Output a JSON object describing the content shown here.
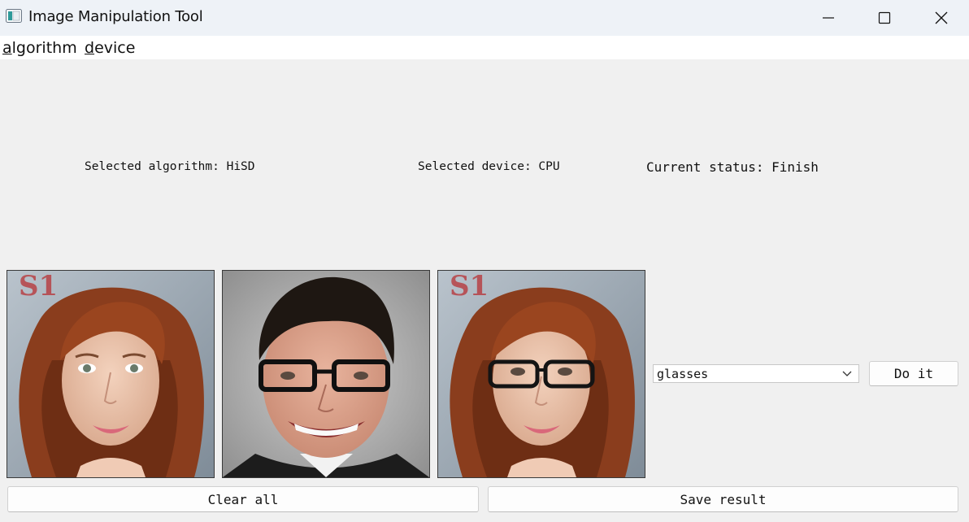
{
  "window": {
    "title": "Image Manipulation Tool"
  },
  "menubar": {
    "items": [
      {
        "mnemonic": "a",
        "rest": "lgorithm"
      },
      {
        "mnemonic": "d",
        "rest": "evice"
      }
    ]
  },
  "status": {
    "algorithm": "Selected algorithm: HiSD",
    "device": "Selected device: CPU",
    "current": "Current status: Finish"
  },
  "images": [
    {
      "role": "source",
      "description_icon": "photo-icon"
    },
    {
      "role": "reference",
      "description_icon": "photo-icon"
    },
    {
      "role": "result",
      "description_icon": "photo-icon"
    }
  ],
  "controls": {
    "attribute_selected": "glasses",
    "do_it_label": "Do it",
    "clear_label": "Clear all",
    "save_label": "Save result"
  },
  "colors": {
    "titlebar_bg": "#eef2f7",
    "window_bg": "#f0f0f0",
    "menubar_bg": "#ffffff"
  }
}
